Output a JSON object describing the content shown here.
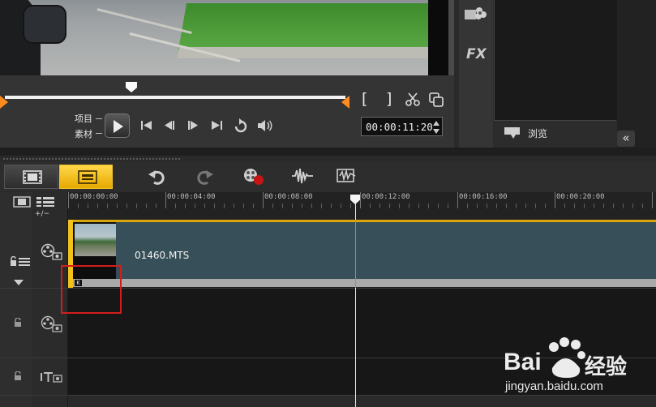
{
  "player": {
    "mode_project": "项目",
    "mode_clip": "素材",
    "bracket_in": "[",
    "bracket_out": "]",
    "timecode": "00:00:11:20",
    "play_progress": 0.37
  },
  "library": {
    "browse_label": "浏览",
    "fx_label": "FX",
    "collapse_symbol": "«"
  },
  "timeline": {
    "ruler_ticks": [
      "00:00:00:00",
      "00:00:04:00",
      "00:00:08:00",
      "00:00:12:00",
      "00:00:16:00",
      "00:00:20:00"
    ],
    "zoom_label": "+/−",
    "clip_name": "01460.MTS"
  },
  "watermark": {
    "brand_prefix": "Bai",
    "brand_suffix": "经验",
    "url": "jingyan.baidu.com"
  },
  "colors": {
    "accent": "#f1c21b",
    "clip": "#374f58",
    "highlight": "#d21d1d",
    "scrub_handle": "#ff8a1f"
  },
  "icons": {
    "storyboard": "film-icon",
    "timeline": "timeline-icon",
    "undo": "undo-icon",
    "redo": "redo-icon",
    "record": "record-capture-icon",
    "audio_mixer": "audio-wave-icon",
    "auto_music": "auto-music-icon"
  }
}
